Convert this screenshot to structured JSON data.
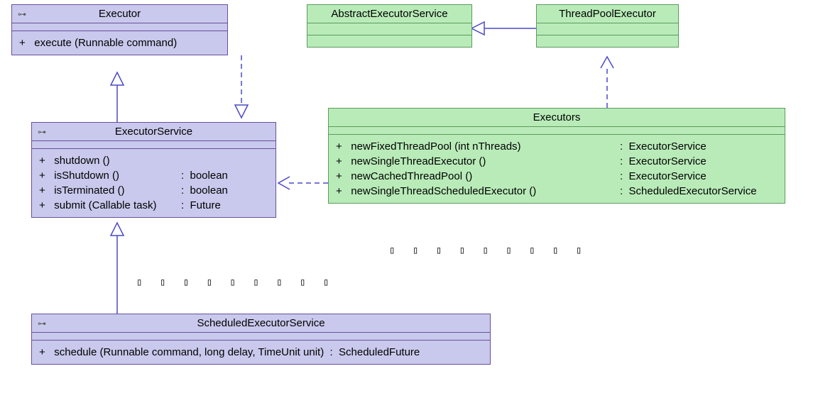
{
  "classes": {
    "executor": {
      "name": "Executor",
      "ops": [
        {
          "sig": "+   execute (Runnable command)",
          "ret": ""
        }
      ]
    },
    "executorService": {
      "name": "ExecutorService",
      "ops": [
        {
          "sig": "+   shutdown ()",
          "ret": ""
        },
        {
          "sig": "+   isShutdown ()",
          "ret": ":  boolean"
        },
        {
          "sig": "+   isTerminated ()",
          "ret": ":  boolean"
        },
        {
          "sig": "+   submit (Callable task)",
          "ret": ":  Future"
        }
      ]
    },
    "scheduledExecutorService": {
      "name": "ScheduledExecutorService",
      "ops": [
        {
          "sig": "+   schedule (Runnable command, long delay, TimeUnit unit)",
          "ret": "  :  ScheduledFuture"
        }
      ]
    },
    "abstractExecutorService": {
      "name": "AbstractExecutorService"
    },
    "threadPoolExecutor": {
      "name": "ThreadPoolExecutor"
    },
    "executors": {
      "name": "Executors",
      "ops": [
        {
          "sig": "+   newFixedThreadPool (int nThreads)",
          "ret": ":  ExecutorService"
        },
        {
          "sig": "+   newSingleThreadExecutor ()",
          "ret": ":  ExecutorService"
        },
        {
          "sig": "+   newCachedThreadPool ()",
          "ret": ":  ExecutorService"
        },
        {
          "sig": "+   newSingleThreadScheduledExecutor ()",
          "ret": ":  ScheduledExecutorService"
        }
      ]
    }
  },
  "dots": "▯ ▯ ▯ ▯ ▯ ▯ ▯ ▯ ▯"
}
